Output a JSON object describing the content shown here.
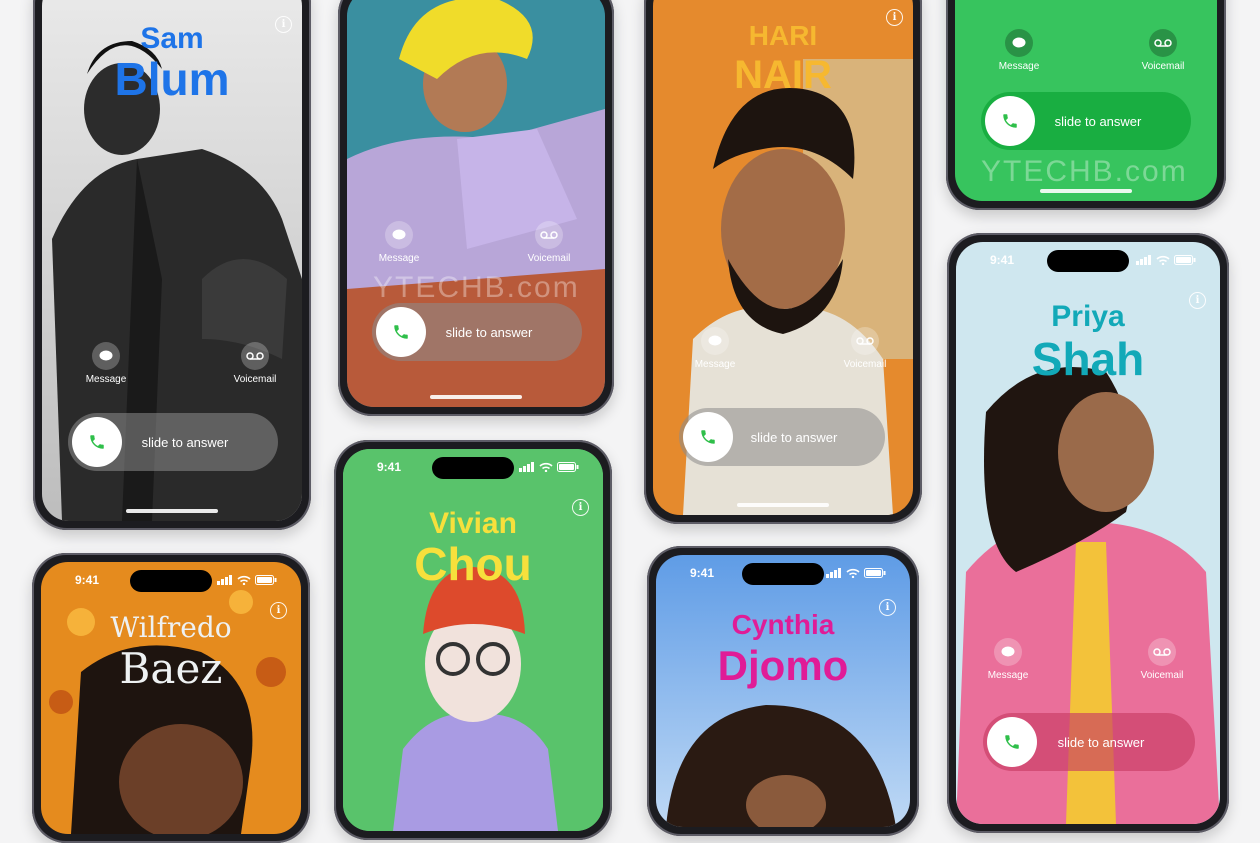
{
  "status_time": "9:41",
  "common": {
    "info_glyph": "i",
    "message_label": "Message",
    "voicemail_label": "Voicemail",
    "slide_label": "slide to answer",
    "watermark": "YTECHB.com"
  },
  "contacts": [
    {
      "first": "Sam",
      "last": "Blum",
      "color": "#1e74e8"
    },
    {
      "first": "",
      "last": "",
      "color": "#ffffff"
    },
    {
      "first": "HARI",
      "last": "NAIR",
      "color": "#f6b830"
    },
    {
      "first": "",
      "last": "",
      "color": "#ffffff"
    },
    {
      "first": "Priya",
      "last": "Shah",
      "color": "#12a9b8"
    },
    {
      "first": "Vivian",
      "last": "Chou",
      "color": "#f7e03c"
    },
    {
      "first": "Wilfredo",
      "last": "Baez",
      "color": "#eef1f2"
    },
    {
      "first": "Cynthia",
      "last": "Djomo",
      "color": "#e01c97"
    }
  ],
  "icons": {
    "message": "message-bubble-icon",
    "voicemail": "voicemail-icon",
    "phone": "phone-icon",
    "info": "info-icon",
    "signal": "signal-icon",
    "wifi": "wifi-icon",
    "battery": "battery-icon"
  }
}
